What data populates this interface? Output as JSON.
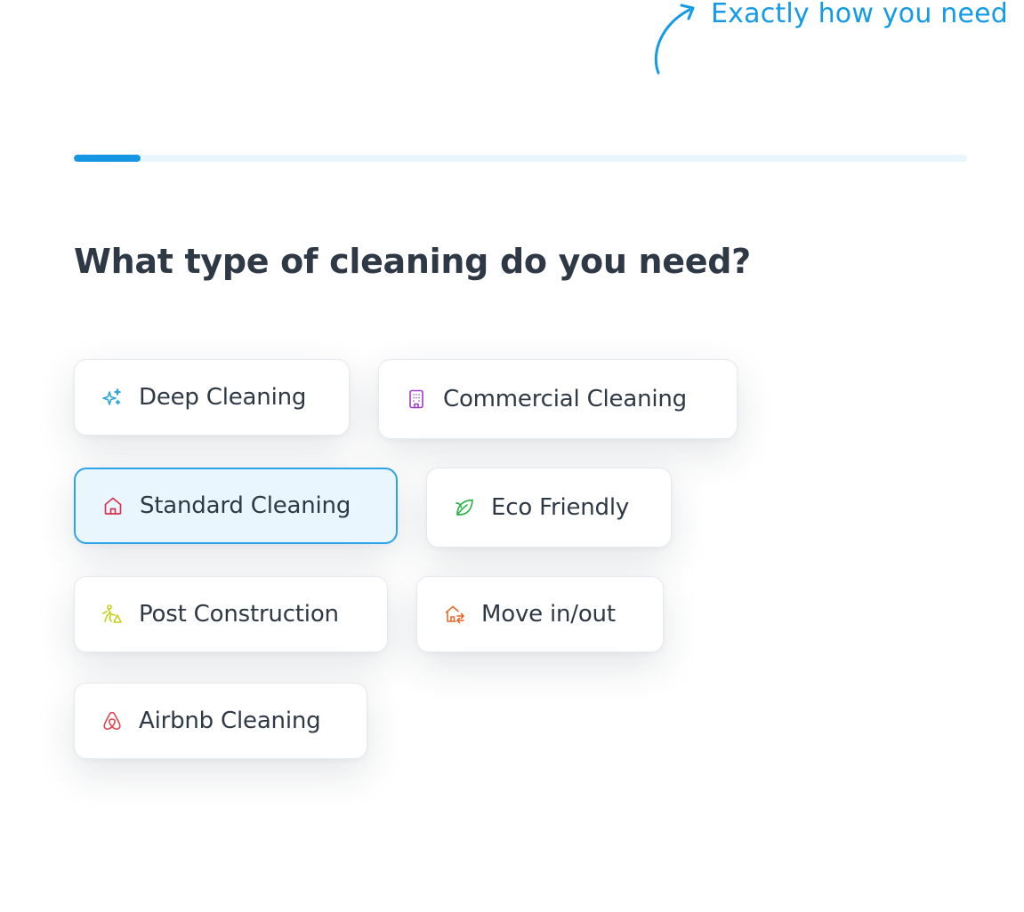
{
  "callout": {
    "text": "Exactly how you need"
  },
  "progress": {
    "fraction": 0.075
  },
  "question": "What type of cleaning do you need?",
  "options": [
    {
      "label": "Deep Cleaning",
      "icon": "sparkles-icon",
      "color": "#2aa6d6",
      "selected": false
    },
    {
      "label": "Commercial Cleaning",
      "icon": "building-icon",
      "color": "#9b3fc9",
      "selected": false
    },
    {
      "label": "Standard Cleaning",
      "icon": "house-icon",
      "color": "#d6334f",
      "selected": true
    },
    {
      "label": "Eco Friendly",
      "icon": "leaf-icon",
      "color": "#2bb34a",
      "selected": false
    },
    {
      "label": "Post Construction",
      "icon": "worker-icon",
      "color": "#c6cf1c",
      "selected": false
    },
    {
      "label": "Move in/out",
      "icon": "house-move-icon",
      "color": "#e26a2c",
      "selected": false
    },
    {
      "label": "Airbnb Cleaning",
      "icon": "airbnb-icon",
      "color": "#e0454f",
      "selected": false
    }
  ],
  "colors": {
    "accent": "#149be6",
    "progress_track": "#e9f6fd",
    "progress_fill": "#1697e4",
    "selected_bg": "#eaf6fd",
    "selected_border": "#2ea3e8",
    "heading": "#2f3946"
  }
}
